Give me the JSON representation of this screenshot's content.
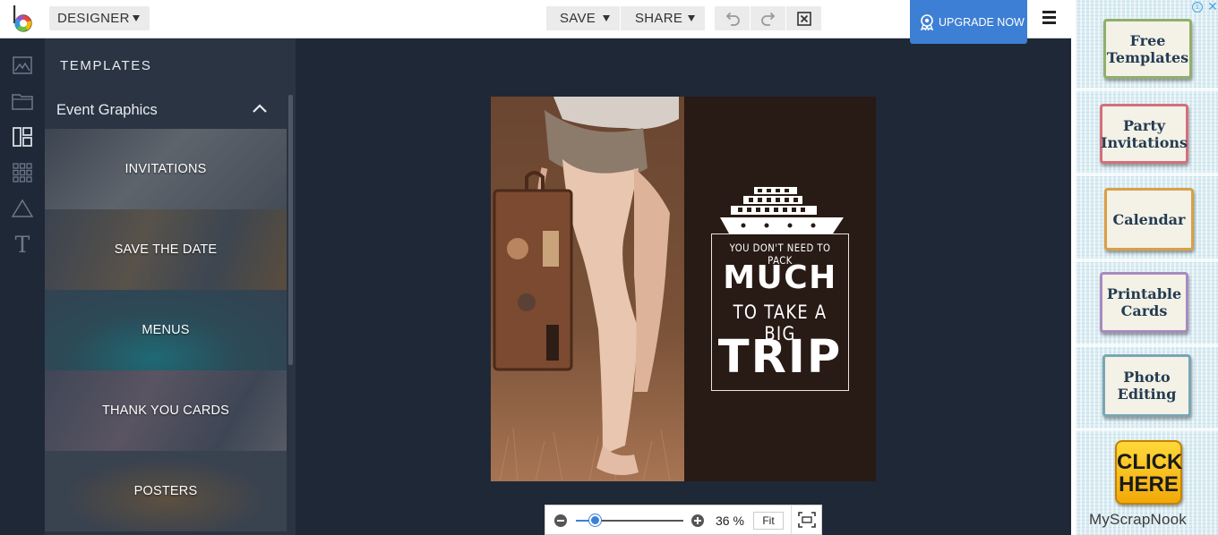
{
  "topbar": {
    "mode_label": "DESIGNER",
    "save_label": "SAVE",
    "share_label": "SHARE",
    "upgrade_label": "UPGRADE NOW"
  },
  "rail": {
    "icons": [
      "image-icon",
      "folder-icon",
      "templates-icon",
      "grid-icon",
      "shapes-icon",
      "text-icon"
    ],
    "text_icon_glyph": "T"
  },
  "panel": {
    "title": "TEMPLATES",
    "category": "Event Graphics",
    "tiles": [
      {
        "label": "INVITATIONS"
      },
      {
        "label": "SAVE THE DATE"
      },
      {
        "label": "MENUS"
      },
      {
        "label": "THANK YOU CARDS"
      },
      {
        "label": "POSTERS"
      }
    ]
  },
  "canvas": {
    "quote_line1": "YOU DON'T NEED TO PACK",
    "quote_line2": "MUCH",
    "quote_line3": "TO TAKE A BIG",
    "quote_line4": "TRIP",
    "background_color": "#281a14"
  },
  "zoom": {
    "percent_label": "36 %",
    "level": 0.18,
    "fit_label": "Fit"
  },
  "ad": {
    "cards": [
      {
        "label": "Free Templates"
      },
      {
        "label": "Party Invitations"
      },
      {
        "label": "Calendar"
      },
      {
        "label": "Printable Cards"
      },
      {
        "label": "Photo Editing"
      }
    ],
    "cta_line1": "CLICK",
    "cta_line2": "HERE",
    "brand": "MyScrapNook"
  },
  "colors": {
    "accent": "#3d7fd4",
    "app_background": "#1f2836",
    "panel_background": "#2a3442"
  }
}
